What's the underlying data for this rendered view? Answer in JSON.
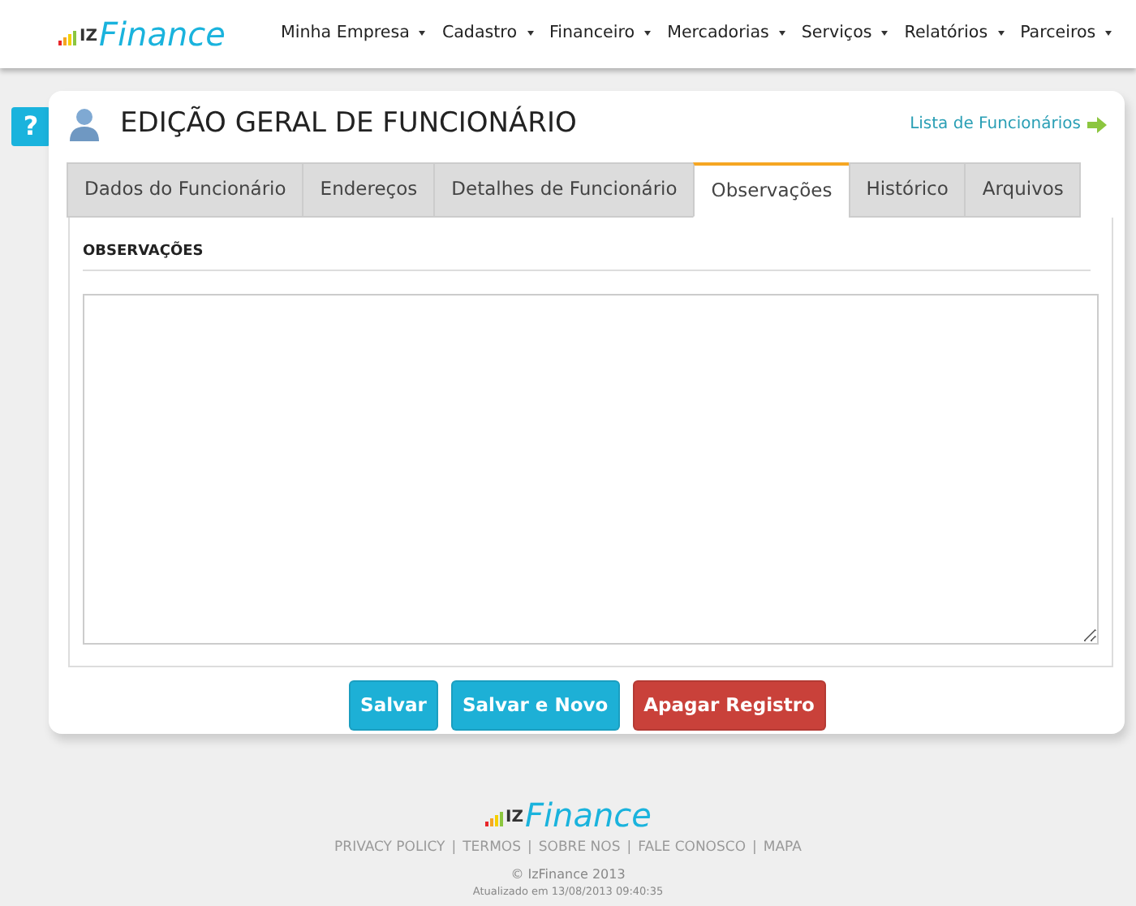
{
  "logo": {
    "prefix": "IZ",
    "name": "Finance"
  },
  "menu": [
    {
      "label": "Minha Empresa"
    },
    {
      "label": "Cadastro"
    },
    {
      "label": "Financeiro"
    },
    {
      "label": "Mercadorias"
    },
    {
      "label": "Serviços"
    },
    {
      "label": "Relatórios"
    },
    {
      "label": "Parceiros"
    }
  ],
  "help": {
    "label": "?"
  },
  "page": {
    "title": "EDIÇÃO GERAL DE FUNCIONÁRIO",
    "back_link": "Lista de Funcionários"
  },
  "tabs": [
    {
      "label": "Dados do Funcionário",
      "selected": false
    },
    {
      "label": "Endereços",
      "selected": false
    },
    {
      "label": "Detalhes de Funcionário",
      "selected": false
    },
    {
      "label": "Observações",
      "selected": true
    },
    {
      "label": "Histórico",
      "selected": false
    },
    {
      "label": "Arquivos",
      "selected": false
    }
  ],
  "section": {
    "heading": "OBSERVAÇÕES"
  },
  "buttons": [
    {
      "label": "Salvar",
      "kind": "primary"
    },
    {
      "label": "Salvar e Novo",
      "kind": "primary"
    },
    {
      "label": "Apagar Registro",
      "kind": "danger"
    }
  ],
  "footer": {
    "logo": {
      "prefix": "IZ",
      "name": "Finance"
    },
    "links": [
      "PRIVACY POLICY",
      "TERMOS",
      "SOBRE NOS",
      "FALE CONOSCO",
      "MAPA"
    ],
    "separator": "|",
    "copyright": "© IzFinance 2013",
    "updated": "Atualizado em 13/08/2013 09:40:35"
  }
}
